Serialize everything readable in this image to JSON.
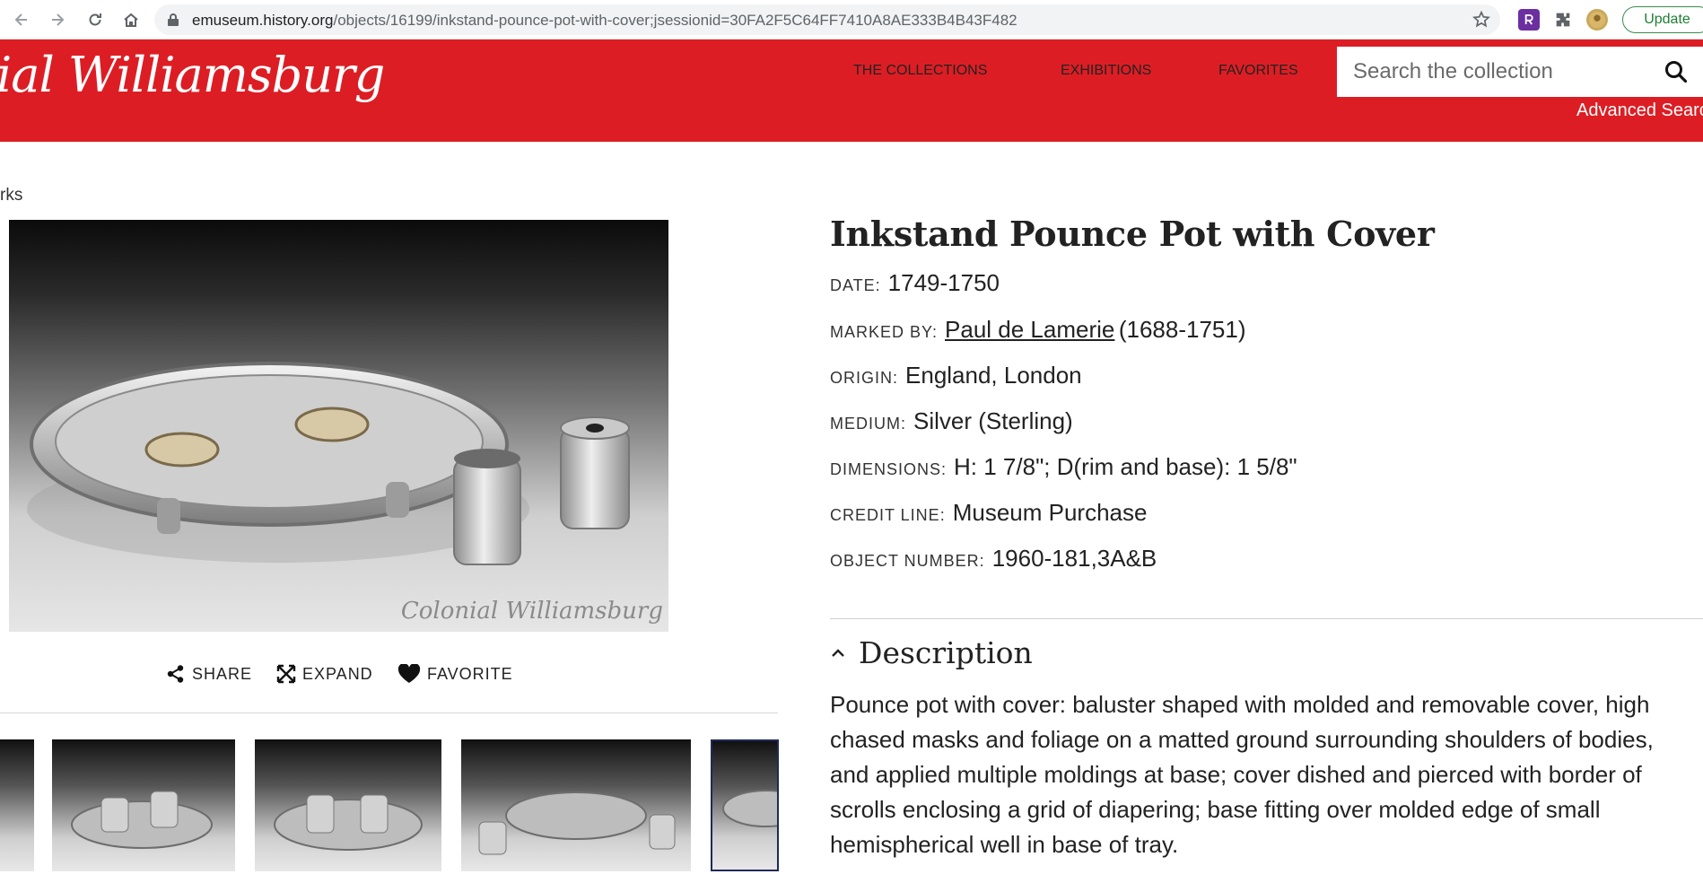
{
  "browser": {
    "url_host": "emuseum.history.org",
    "url_path": "/objects/16199/inkstand-pounce-pot-with-cover;jsessionid=30FA2F5C64FF7410A8AE333B4B43F482",
    "update_label": "Update"
  },
  "header": {
    "logo_text": "ial Williamsburg",
    "nav": [
      "THE COLLECTIONS",
      "EXHIBITIONS",
      "FAVORITES"
    ],
    "search_placeholder": "Search the collection",
    "advanced_search": "Advanced Search"
  },
  "breadcrumb_fragment": "rks",
  "image": {
    "watermark": "Colonial Williamsburg",
    "actions": [
      "SHARE",
      "EXPAND",
      "FAVORITE"
    ]
  },
  "object": {
    "title": "Inkstand Pounce Pot with Cover",
    "facts": [
      {
        "label": "DATE:",
        "value": "1749-1750"
      },
      {
        "label": "MARKED BY:",
        "link": "Paul de Lamerie",
        "value": "(1688-1751)"
      },
      {
        "label": "ORIGIN:",
        "value": "England, London"
      },
      {
        "label": "MEDIUM:",
        "value": "Silver (Sterling)"
      },
      {
        "label": "DIMENSIONS:",
        "value": "H: 1 7/8\"; D(rim and base): 1 5/8\""
      },
      {
        "label": "CREDIT LINE:",
        "value": "Museum Purchase"
      },
      {
        "label": "OBJECT NUMBER:",
        "value": "1960-181,3A&B"
      }
    ],
    "description_heading": "Description",
    "description": "Pounce pot with cover: baluster shaped with molded and removable cover, high chased masks and foliage on a matted ground surrounding shoulders of bodies, and applied multiple moldings at base; cover dished and pierced with border of scrolls enclosing a grid of diapering; base fitting over molded edge of small hemispherical well in base of tray."
  }
}
